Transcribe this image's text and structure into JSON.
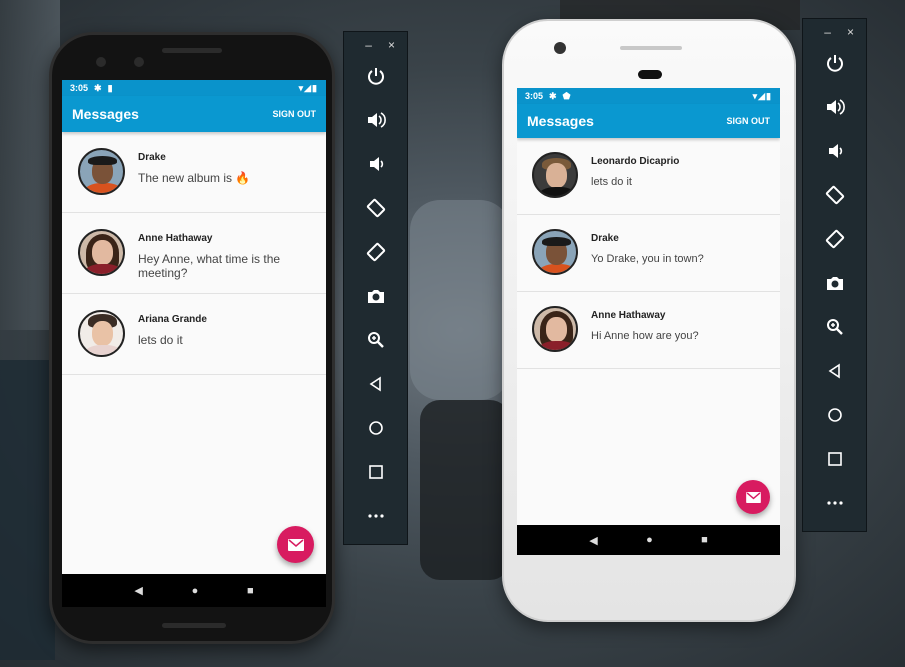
{
  "colors": {
    "app_bar": "#0a98d0",
    "status_bar": "#0a93cb",
    "fab": "#d81b60",
    "toolbar": "#1f2a30"
  },
  "emulator_toolbar": {
    "window_controls": [
      {
        "icon": "minimize-icon",
        "glyph": "–"
      },
      {
        "icon": "close-icon",
        "glyph": "×"
      }
    ],
    "buttons": [
      "power-icon",
      "volume-up-icon",
      "volume-down-icon",
      "rotate-left-icon",
      "rotate-right-icon",
      "camera-icon",
      "zoom-icon",
      "back-icon",
      "home-icon",
      "overview-icon",
      "more-icon"
    ]
  },
  "phone_a": {
    "status": {
      "time": "3:05",
      "icons_right": "▾◢▮"
    },
    "app_bar": {
      "title": "Messages",
      "sign_out": "SIGN OUT"
    },
    "messages": [
      {
        "name": "Drake",
        "text": "The new album is 🔥"
      },
      {
        "name": "Anne Hathaway",
        "text": "Hey Anne, what time is the meeting?"
      },
      {
        "name": "Ariana Grande",
        "text": "lets do it"
      }
    ],
    "fab_icon": "mail-icon",
    "nav": {
      "back": "◀",
      "home": "●",
      "overview": "■"
    }
  },
  "phone_b": {
    "status": {
      "time": "3:05",
      "icons_right": "▾◢▮"
    },
    "app_bar": {
      "title": "Messages",
      "sign_out": "SIGN OUT"
    },
    "messages": [
      {
        "name": "Leonardo Dicaprio",
        "text": "lets do it"
      },
      {
        "name": "Drake",
        "text": "Yo Drake, you in town?"
      },
      {
        "name": "Anne Hathaway",
        "text": "Hi Anne how are you?"
      }
    ],
    "fab_icon": "mail-icon",
    "nav": {
      "back": "◀",
      "home": "●",
      "overview": "■"
    }
  }
}
